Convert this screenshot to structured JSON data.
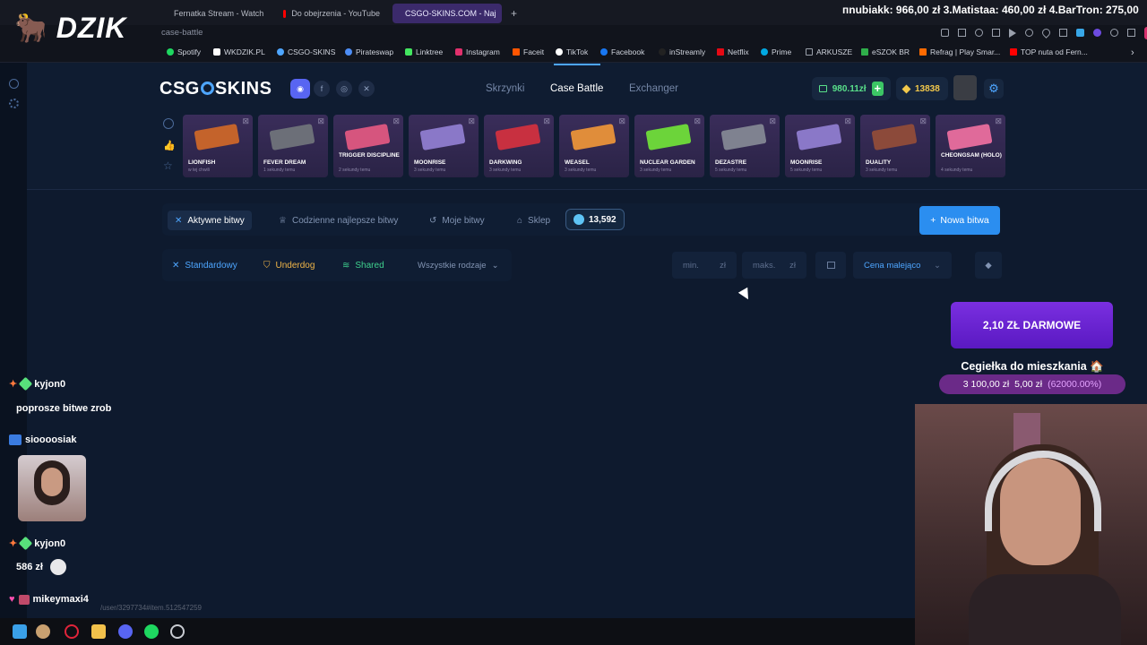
{
  "overlay": {
    "stream_logo": "🐂 DZIK",
    "ticker": "пnubiakk: 966,00 zł   3.Matistaa: 460,00 zł   4.BarTron: 275,00"
  },
  "browser": {
    "tabs": [
      {
        "label": "Fernatka Stream - Watch",
        "color": "#53fc18"
      },
      {
        "label": "Do obejrzenia - YouTube",
        "color": "#ff0000"
      },
      {
        "label": "CSGO-SKINS.COM - Naj",
        "color": "#4ea6ff"
      }
    ],
    "new_tab": "+",
    "url_fragment": "case-battle",
    "bookmarks": [
      {
        "label": "Spotify",
        "color": "#1ed760"
      },
      {
        "label": "WKDZIK.PL",
        "color": "#ffffff"
      },
      {
        "label": "CSGO-SKINS",
        "color": "#4ea6ff"
      },
      {
        "label": "Pirateswap",
        "color": "#4d8df5"
      },
      {
        "label": "Linktree",
        "color": "#43e660"
      },
      {
        "label": "Instagram",
        "color": "#e1306c"
      },
      {
        "label": "Faceit",
        "color": "#ff5500"
      },
      {
        "label": "TikTok",
        "color": "#ffffff"
      },
      {
        "label": "Facebook",
        "color": "#1877f2"
      },
      {
        "label": "inStreamly",
        "color": "#222222"
      },
      {
        "label": "Netflix",
        "color": "#e50914"
      },
      {
        "label": "Prime",
        "color": "#00a8e1"
      },
      {
        "label": "ARKUSZE",
        "color": "#9aa0aa"
      },
      {
        "label": "eSZOK BR",
        "color": "#2fae4a"
      },
      {
        "label": "Refrag | Play Smar...",
        "color": "#ff6a00"
      },
      {
        "label": "TOP nuta od Fern...",
        "color": "#ff0000"
      }
    ]
  },
  "site": {
    "logo_left": "CSG",
    "logo_right": "SKINS",
    "nav": [
      "Skrzynki",
      "Case Battle",
      "Exchanger"
    ],
    "balance": "980.11zł",
    "coins": "13838",
    "live_drops": [
      {
        "name": "LIONFISH",
        "sub": "w tej chwili",
        "color": "#c4632b"
      },
      {
        "name": "FEVER DREAM",
        "sub": "1 sekundy temu",
        "color": "#6c6f78"
      },
      {
        "name": "TRIGGER DISCIPLINE",
        "sub": "2 sekundy temu",
        "color": "#d6557e"
      },
      {
        "name": "MOONRISE",
        "sub": "3 sekundy temu",
        "color": "#8a78c8"
      },
      {
        "name": "DARKWING",
        "sub": "3 sekundy temu",
        "color": "#c83040"
      },
      {
        "name": "WEASEL",
        "sub": "3 sekundy temu",
        "color": "#e08d3a"
      },
      {
        "name": "NUCLEAR GARDEN",
        "sub": "3 sekundy temu",
        "color": "#6cd43a"
      },
      {
        "name": "DEZASTRE",
        "sub": "5 sekundy temu",
        "color": "#7f8290"
      },
      {
        "name": "MOONRISE",
        "sub": "5 sekundy temu",
        "color": "#8a78c8"
      },
      {
        "name": "DUALITY",
        "sub": "3 sekundy temu",
        "color": "#8c4a3a"
      },
      {
        "name": "CHEONGSAM (HOLO)",
        "sub": "4 sekundy temu",
        "color": "#e06a9a"
      }
    ],
    "battle_tabs": [
      "Aktywne bitwy",
      "Codzienne najlepsze bitwy",
      "Moje bitwy",
      "Sklep"
    ],
    "battle_coins": "13,592",
    "new_battle": "Nowa bitwa",
    "filters": [
      "Standardowy",
      "Underdog",
      "Shared"
    ],
    "filter_colors": [
      "#4ea6ff",
      "#f0b548",
      "#3fd18e"
    ],
    "type_select": "Wszystkie rodzaje",
    "min_placeholder": "min.",
    "max_placeholder": "maks.",
    "currency": "zł",
    "sort_select": "Cena malejąco"
  },
  "chat": [
    {
      "user": "kyjon0",
      "msg": "poprosze bitwe zrob"
    },
    {
      "user": "sioooosiak",
      "msg": ""
    },
    {
      "user": "kyjon0",
      "msg": "586 zł"
    },
    {
      "user": "mikeymaxi4",
      "msg": ""
    }
  ],
  "promo": {
    "button": "2,10 ZŁ DARMOWE",
    "goal_title": "Cegiełka do mieszkania 🏠",
    "goal_current": "3 100,00 zł",
    "goal_target": "5,00 zł",
    "goal_percent": "(62000.00%)"
  },
  "status_url": "/user/3297734#item.512547259"
}
